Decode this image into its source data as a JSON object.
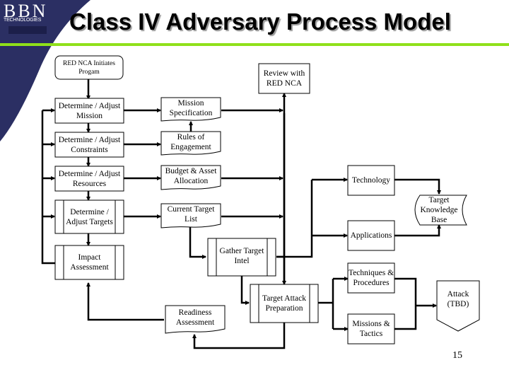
{
  "slide": {
    "title": "Class IV Adversary Process Model",
    "page_number": "15",
    "logo": {
      "name": "BBN",
      "subtitle": "TECHNOLOGIES"
    },
    "colors": {
      "brand_navy": "#2b2f63",
      "accent_green": "#8fe01a",
      "line": "#000000"
    }
  },
  "nodes": {
    "start": "RED NCA Initiates Progam",
    "review": "Review with RED NCA",
    "mission": "Determine / Adjust Mission",
    "constraints": "Determine / Adjust Constraints",
    "resources": "Determine / Adjust Resources",
    "targets": "Determine / Adjust Targets",
    "impact": "Impact Assessment",
    "mission_spec": "Mission Specification",
    "roe": "Rules of Engagement",
    "budget": "Budget & Asset Allocation",
    "target_list": "Current Target List",
    "gather": "Gather Target Intel",
    "readiness": "Readiness Assessment",
    "prep": "Target Attack Preparation",
    "technology": "Technology",
    "applications": "Applications",
    "tkb": "Target Knowledge Base",
    "techniques": "Techniques & Procedures",
    "missions_tactics": "Missions & Tactics",
    "attack": "Attack (TBD)"
  }
}
